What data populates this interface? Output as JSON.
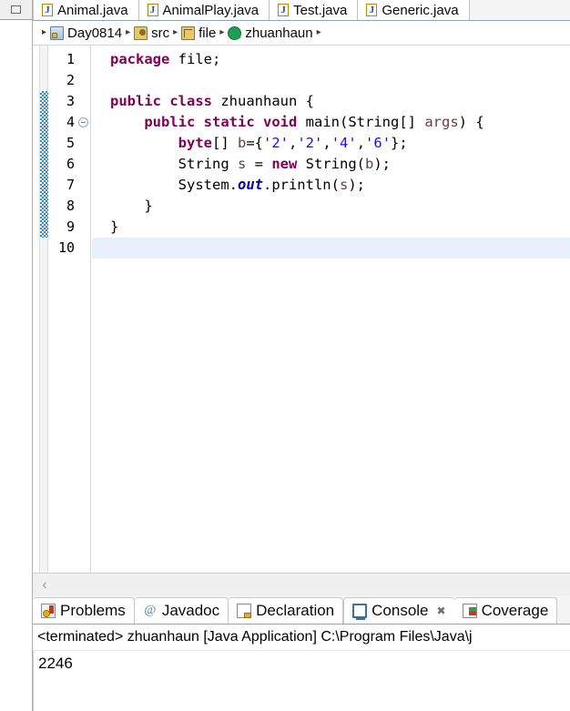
{
  "window": {
    "restore_icon": "restore-icon"
  },
  "editor": {
    "tabs": [
      {
        "label": "Animal.java",
        "icon": "java-file-icon",
        "active": false
      },
      {
        "label": "AnimalPlay.java",
        "icon": "java-file-icon",
        "active": false
      },
      {
        "label": "Test.java",
        "icon": "java-file-icon",
        "active": false
      },
      {
        "label": "Generic.java",
        "icon": "java-file-icon",
        "active": false
      }
    ],
    "breadcrumb": [
      {
        "label": "Day0814",
        "icon": "project-icon"
      },
      {
        "label": "src",
        "icon": "source-folder-icon"
      },
      {
        "label": "file",
        "icon": "package-icon"
      },
      {
        "label": "zhuanhaun",
        "icon": "class-icon"
      }
    ],
    "breadcrumb_separator": "▸",
    "line_numbers": [
      "1",
      "2",
      "3",
      "4",
      "5",
      "6",
      "7",
      "8",
      "9",
      "10"
    ],
    "current_line": "10",
    "fold_line": "4",
    "changed_lines_from": "3",
    "changed_lines_to": "9",
    "code": [
      {
        "n": "1",
        "tokens": [
          {
            "t": "package",
            "c": "kw"
          },
          {
            "t": " file;",
            "c": "plain"
          }
        ]
      },
      {
        "n": "2",
        "tokens": []
      },
      {
        "n": "3",
        "tokens": [
          {
            "t": "public",
            "c": "kw"
          },
          {
            "t": " ",
            "c": "plain"
          },
          {
            "t": "class",
            "c": "kw"
          },
          {
            "t": " zhuanhaun {",
            "c": "plain"
          }
        ]
      },
      {
        "n": "4",
        "tokens": [
          {
            "t": "    ",
            "c": "plain"
          },
          {
            "t": "public",
            "c": "kw"
          },
          {
            "t": " ",
            "c": "plain"
          },
          {
            "t": "static",
            "c": "kw"
          },
          {
            "t": " ",
            "c": "plain"
          },
          {
            "t": "void",
            "c": "kw"
          },
          {
            "t": " main(String[] ",
            "c": "plain"
          },
          {
            "t": "args",
            "c": "lvar"
          },
          {
            "t": ") {",
            "c": "plain"
          }
        ]
      },
      {
        "n": "5",
        "tokens": [
          {
            "t": "        ",
            "c": "plain"
          },
          {
            "t": "byte",
            "c": "kw"
          },
          {
            "t": "[] ",
            "c": "plain"
          },
          {
            "t": "b",
            "c": "lvar"
          },
          {
            "t": "={",
            "c": "plain"
          },
          {
            "t": "'2'",
            "c": "str"
          },
          {
            "t": ",",
            "c": "plain"
          },
          {
            "t": "'2'",
            "c": "str"
          },
          {
            "t": ",",
            "c": "plain"
          },
          {
            "t": "'4'",
            "c": "str"
          },
          {
            "t": ",",
            "c": "plain"
          },
          {
            "t": "'6'",
            "c": "str"
          },
          {
            "t": "};",
            "c": "plain"
          }
        ]
      },
      {
        "n": "6",
        "tokens": [
          {
            "t": "        String ",
            "c": "plain"
          },
          {
            "t": "s",
            "c": "lvar"
          },
          {
            "t": " = ",
            "c": "plain"
          },
          {
            "t": "new",
            "c": "kw"
          },
          {
            "t": " String(",
            "c": "plain"
          },
          {
            "t": "b",
            "c": "lvar"
          },
          {
            "t": ");",
            "c": "plain"
          }
        ]
      },
      {
        "n": "7",
        "tokens": [
          {
            "t": "        System.",
            "c": "plain"
          },
          {
            "t": "out",
            "c": "sfld"
          },
          {
            "t": ".println(",
            "c": "plain"
          },
          {
            "t": "s",
            "c": "lvar"
          },
          {
            "t": ");",
            "c": "plain"
          }
        ]
      },
      {
        "n": "8",
        "tokens": [
          {
            "t": "    }",
            "c": "plain"
          }
        ]
      },
      {
        "n": "9",
        "tokens": [
          {
            "t": "}",
            "c": "plain"
          }
        ]
      },
      {
        "n": "10",
        "tokens": []
      }
    ],
    "hscroll_left_glyph": "‹"
  },
  "console_part": {
    "tabs": [
      {
        "label": "Problems",
        "icon": "problems-icon",
        "active": false,
        "closable": false
      },
      {
        "label": "Javadoc",
        "icon": "javadoc-icon",
        "active": false,
        "closable": false
      },
      {
        "label": "Declaration",
        "icon": "declaration-icon",
        "active": false,
        "closable": false
      },
      {
        "label": "Console",
        "icon": "console-icon",
        "active": true,
        "closable": true
      },
      {
        "label": "Coverage",
        "icon": "coverage-icon",
        "active": false,
        "closable": false
      }
    ],
    "close_glyph": "✖",
    "javadoc_glyph": "@",
    "title": "<terminated> zhuanhaun [Java Application] C:\\Program Files\\Java\\j",
    "output": [
      "2246"
    ]
  },
  "colors": {
    "keyword": "#7f0055",
    "string": "#2a00ff",
    "local_var": "#6a3e3e",
    "static_field": "#0000c0",
    "current_line_bg": "#e8f1fb",
    "change_bar": "#2e8bc9",
    "tab_border": "#8fa3bb"
  }
}
